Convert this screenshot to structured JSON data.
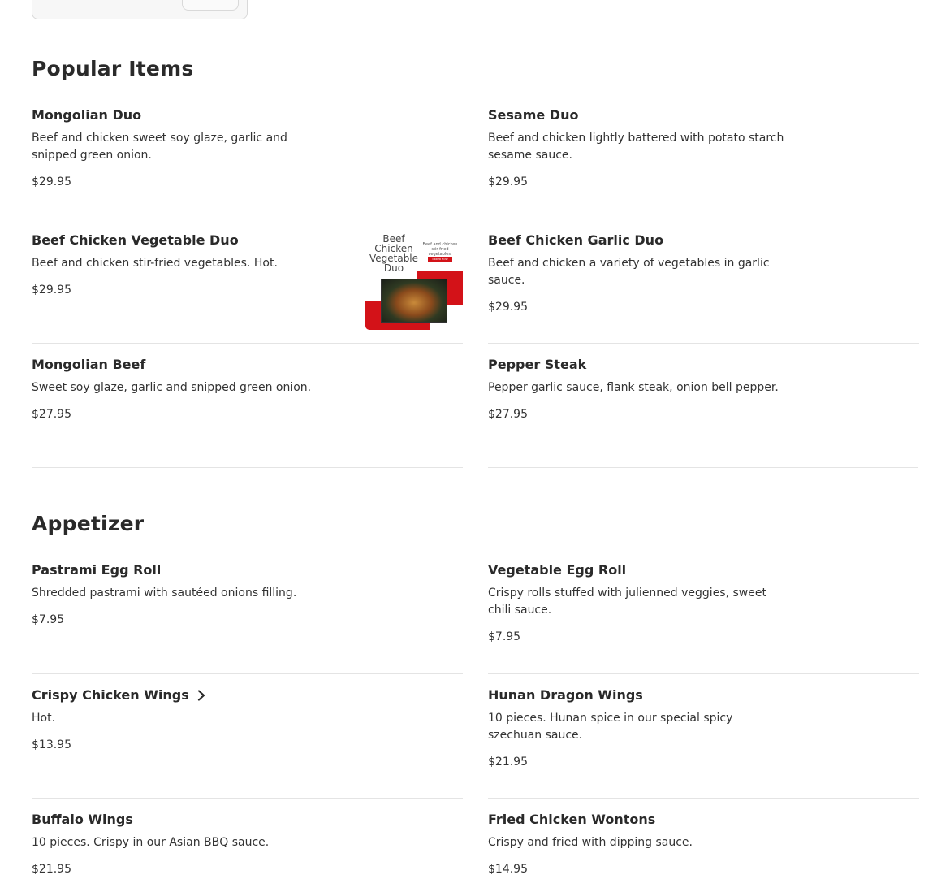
{
  "sections": [
    {
      "title": "Popular Items",
      "items": [
        {
          "name": "Mongolian Duo",
          "desc": "Beef and chicken sweet soy glaze, garlic and snipped green onion.",
          "price": "$29.95"
        },
        {
          "name": "Sesame Duo",
          "desc": "Beef and chicken lightly battered with potato starch sesame sauce.",
          "price": "$29.95"
        },
        {
          "name": "Beef Chicken Vegetable Duo",
          "desc": "Beef and chicken stir-fried vegetables. Hot.",
          "price": "$29.95",
          "image": {
            "title": "Beef Chicken Vegetable Duo",
            "side_text": "Beef and chicken stir fried vegetables.",
            "button_text": "ORDER NOW"
          }
        },
        {
          "name": "Beef Chicken Garlic Duo",
          "desc": "Beef and chicken a variety of vegetables in garlic sauce.",
          "price": "$29.95"
        },
        {
          "name": "Mongolian Beef",
          "desc": "Sweet soy glaze, garlic and snipped green onion.",
          "price": "$27.95"
        },
        {
          "name": "Pepper Steak",
          "desc": "Pepper garlic sauce, flank steak, onion bell pepper.",
          "price": "$27.95"
        }
      ]
    },
    {
      "title": "Appetizer",
      "items": [
        {
          "name": "Pastrami Egg Roll",
          "desc": "Shredded pastrami with sautéed onions filling.",
          "price": "$7.95"
        },
        {
          "name": "Vegetable Egg Roll",
          "desc": "Crispy rolls stuffed with julienned veggies, sweet chili sauce.",
          "price": "$7.95"
        },
        {
          "name": "Crispy Chicken Wings",
          "desc": "Hot.",
          "price": "$13.95",
          "icon": "chevron-right-icon"
        },
        {
          "name": "Hunan Dragon Wings",
          "desc": "10 pieces. Hunan spice in our special spicy szechuan sauce.",
          "price": "$21.95"
        },
        {
          "name": "Buffalo Wings",
          "desc": "10 pieces. Crispy in our Asian BBQ sauce.",
          "price": "$21.95"
        },
        {
          "name": "Fried Chicken Wontons",
          "desc": "Crispy and fried with dipping sauce.",
          "price": "$14.95"
        }
      ]
    }
  ],
  "colors": {
    "accent_red": "#d31218",
    "divider": "#e4e4e4",
    "text": "#2a2a2a"
  }
}
